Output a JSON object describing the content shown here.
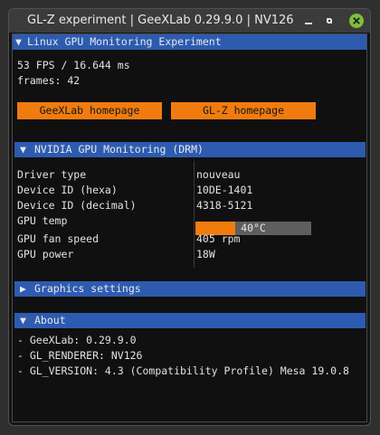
{
  "window": {
    "title": "GL-Z experiment | GeeXLab 0.29.9.0 | NV126"
  },
  "panel": {
    "title": "Linux GPU Monitoring Experiment",
    "fps_line": "53 FPS / 16.644 ms",
    "frames_line": "frames: 42",
    "buttons": [
      "GeeXLab homepage",
      "GL-Z homepage"
    ]
  },
  "gpu": {
    "header": "NVIDIA GPU Monitoring (DRM)",
    "rows": [
      {
        "label": "Driver type",
        "value": "nouveau"
      },
      {
        "label": "Device ID (hexa)",
        "value": "10DE-1401"
      },
      {
        "label": "Device ID (decimal)",
        "value": "4318-5121"
      },
      {
        "label": "GPU temp",
        "value": "40°C"
      },
      {
        "label": "GPU fan speed",
        "value": "405 rpm"
      },
      {
        "label": "GPU power",
        "value": "18W"
      }
    ],
    "temp_fraction": 0.34
  },
  "graphics": {
    "header": "Graphics settings"
  },
  "about": {
    "header": "About",
    "lines": [
      "- GeeXLab: 0.29.9.0",
      "- GL_RENDERER: NV126",
      "- GL_VERSION: 4.3 (Compatibility Profile) Mesa 19.0.8"
    ]
  },
  "colors": {
    "header_blue": "#2d5bb0",
    "button_orange": "#f07c10",
    "close_green": "#7fbf3c"
  },
  "icons": [
    "minimize-icon",
    "restore-icon",
    "close-icon",
    "collapse-arrow-icon",
    "expand-arrow-icon"
  ]
}
